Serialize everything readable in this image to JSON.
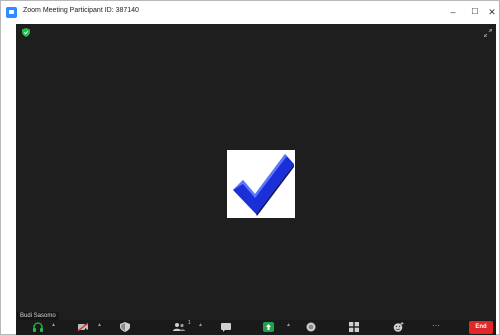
{
  "window": {
    "title": "Zoom Meeting Participant ID: 387140",
    "controls": {
      "minimize": "–",
      "maximize": "☐",
      "close": "✕"
    }
  },
  "video": {
    "participant_name": "Budi Sasomo",
    "content_image": "checkmark-image",
    "background_color": "#1e1e1e"
  },
  "toolbar": {
    "participants_count": "1",
    "more_label": "···",
    "end_label": "End",
    "icons": [
      "audio-icon",
      "video-off-icon",
      "security-icon",
      "participants-icon",
      "chat-icon",
      "share-screen-icon",
      "record-icon",
      "breakout-rooms-icon",
      "reactions-icon",
      "more-icon"
    ],
    "accent_colors": {
      "share": "#1fa34a",
      "end": "#e02828",
      "shield": "#1fbf4a"
    }
  }
}
